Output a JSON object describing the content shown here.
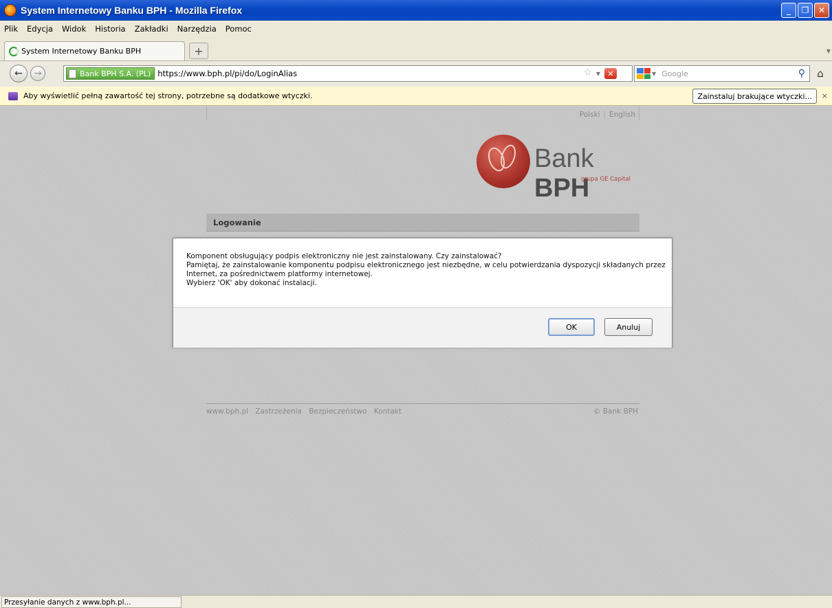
{
  "window": {
    "title": "System Internetowy Banku BPH - Mozilla Firefox",
    "buttons": {
      "minimize": "_",
      "maximize": "❐",
      "close": "✕"
    }
  },
  "menu": {
    "items": [
      "Plik",
      "Edycja",
      "Widok",
      "Historia",
      "Zakładki",
      "Narzędzia",
      "Pomoc"
    ]
  },
  "tabs": {
    "active_label": "System Internetowy Banku BPH",
    "new_tab": "+"
  },
  "nav": {
    "back": "←",
    "forward": "→",
    "identity": "Bank BPH S.A. (PL)",
    "url": "https://www.bph.pl/pi/do/LoginAlias",
    "star": "☆",
    "stop": "✕",
    "search_placeholder": "Google",
    "search_icon": "⚲",
    "home": "⌂"
  },
  "notification": {
    "message": "Aby wyświetlić pełną zawartość tej strony, potrzebne są dodatkowe wtyczki.",
    "install_button": "Zainstaluj brakujące wtyczki...",
    "close": "×"
  },
  "page": {
    "lang_polski": "Polski",
    "lang_english": "English",
    "logo_text_a": "Bank ",
    "logo_text_b": "BPH",
    "logo_sub": "grupa GE Capital",
    "section_title": "Logowanie",
    "footer_links": [
      "www.bph.pl",
      "Zastrzeżenia",
      "Bezpieczeństwo",
      "Kontakt"
    ],
    "footer_copy": "© Bank BPH"
  },
  "dialog": {
    "line1": "Komponent obsługujący podpis elektroniczny nie jest zainstalowany. Czy zainstalować?",
    "line2": "Pamiętaj, że zainstalowanie komponentu podpisu elektronicznego jest niezbędne, w celu potwierdzania dyspozycji składanych przez",
    "line3": "Internet, za pośrednictwem platformy internetowej.",
    "line4": "Wybierz 'OK' aby dokonać instalacji.",
    "ok": "OK",
    "cancel": "Anuluj"
  },
  "status": {
    "text": "Przesyłanie danych z www.bph.pl..."
  }
}
